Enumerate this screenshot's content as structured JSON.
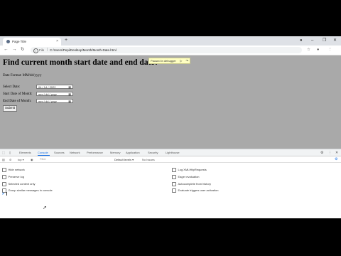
{
  "browser": {
    "tab_title": "Page Title",
    "tab_close": "×",
    "new_tab": "+",
    "win_min": "–",
    "win_max": "❐",
    "win_close": "✕",
    "profile_icon": "●",
    "back": "←",
    "forward": "→",
    "reload": "↻",
    "info": "i",
    "file_label": "File",
    "separator": "|",
    "url": "C:/Users/Pepi/Desktop/Month/Month-Date.html",
    "star": "☆",
    "profile": "●",
    "menu": "⋮"
  },
  "page": {
    "heading": "Find current month start date and end date?",
    "format": "Date Format: MM/dd/yyyy",
    "select_date_label": "Select Date:",
    "select_date_value": "04 / 14 / 2022",
    "start_label": "Start Date of Month:",
    "start_value": "mm / dd / yyyy",
    "end_label": "End Date of Month:",
    "end_value": "mm / dd / yyyy",
    "calendar_glyph": "▦",
    "submit": "Submit",
    "debugger_text": "Paused in debugger",
    "resume_icon": "▷",
    "step_icon": "↷"
  },
  "devtools": {
    "tabs": [
      "Elements",
      "Console",
      "Sources",
      "Network",
      "Performance",
      "Memory",
      "Application",
      "Security",
      "Lighthouse"
    ],
    "active_tab": "Console",
    "settings": "⚙",
    "more": "⋮",
    "close": "✕",
    "clear_icon": "⊘",
    "context": "top ▾",
    "eye_icon": "◉",
    "filter_placeholder": "Filter",
    "levels": "Default levels ▾",
    "issues": "No Issues",
    "gear": "⚙",
    "options_left": [
      "Hide network",
      "Preserve log",
      "Selected context only",
      "Group similar messages in console"
    ],
    "options_right": [
      "Log XMLHttpRequests",
      "Eager evaluation",
      "Autocomplete from history",
      "Evaluate triggers user activation"
    ],
    "prompt": ">",
    "cursor": "➚"
  },
  "colors": {
    "page_bg": "#a9a9a9",
    "accent": "#1a73e8",
    "debugger_bg": "#ffffc2"
  }
}
